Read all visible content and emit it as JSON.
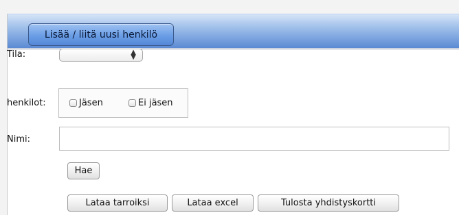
{
  "header": {
    "add_person_button": "Lisää / liitä uusi henkilö"
  },
  "form": {
    "tila": {
      "label": "Tila:",
      "selected": ""
    },
    "henkilot": {
      "label": "henkilot:",
      "options": [
        {
          "label": "Jäsen",
          "checked": false
        },
        {
          "label": "Ei jäsen",
          "checked": false
        }
      ]
    },
    "nimi": {
      "label": "Nimi:",
      "value": ""
    }
  },
  "buttons": {
    "search": "Hae",
    "labels": "Lataa tarroiksi",
    "excel": "Lataa excel",
    "print_card": "Tulosta yhdistyskortti"
  },
  "icons": {
    "select_arrows": "up-down-arrows-icon"
  },
  "colors": {
    "header_gradient_top": "#d5e4f7",
    "header_gradient_bottom": "#5b8ad3",
    "header_button": "#6b9ee6"
  }
}
